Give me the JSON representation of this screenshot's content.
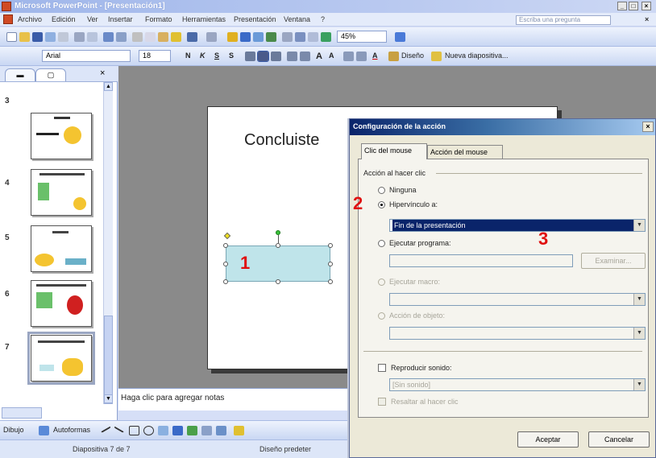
{
  "window": {
    "title": "Microsoft PowerPoint - [Presentación1]",
    "controls": [
      "_",
      "□",
      "×"
    ]
  },
  "menu": {
    "items": [
      "Archivo",
      "Edición",
      "Ver",
      "Insertar",
      "Formato",
      "Herramientas",
      "Presentación",
      "Ventana",
      "?"
    ],
    "ask_placeholder": "Escriba una pregunta",
    "close": "×"
  },
  "toolbar": {
    "zoom": "45%",
    "font_name": "Arial",
    "font_size": "18",
    "bold": "N",
    "italic": "K",
    "underline": "S",
    "shadow": "S",
    "grow_font": "A",
    "shrink_font": "A",
    "font_color": "A",
    "design_label": "Diseño",
    "new_slide_label": "Nueva diapositiva..."
  },
  "left_pane": {
    "close": "×",
    "thumbnails": [
      {
        "num": "3"
      },
      {
        "num": "4"
      },
      {
        "num": "5"
      },
      {
        "num": "6"
      },
      {
        "num": "7",
        "selected": true
      }
    ]
  },
  "slide": {
    "title": "Concluiste"
  },
  "annotations": [
    "1",
    "2",
    "3"
  ],
  "notes_placeholder": "Haga clic para agregar notas",
  "drawbar": {
    "draw_label": "Dibujo",
    "autoshapes_label": "Autoformas"
  },
  "status": {
    "slide_count": "Diapositiva 7 de 7",
    "design": "Diseño predeter"
  },
  "dialog": {
    "title": "Configuración de la acción",
    "close": "×",
    "tabs": [
      "Clic del mouse",
      "Acción del mouse"
    ],
    "group_label": "Acción al hacer clic",
    "options": {
      "none": "Ninguna",
      "hyperlink": "Hipervínculo a:",
      "run_program": "Ejecutar programa:",
      "run_macro": "Ejecutar macro:",
      "object_action": "Acción de objeto:"
    },
    "hyperlink_value": "Fin de la presentación",
    "browse_button": "Examinar...",
    "play_sound_label": "Reproducir sonido:",
    "sound_value": "[Sin sonido]",
    "highlight_label": "Resaltar al hacer clic",
    "ok_button": "Aceptar",
    "cancel_button": "Cancelar"
  }
}
